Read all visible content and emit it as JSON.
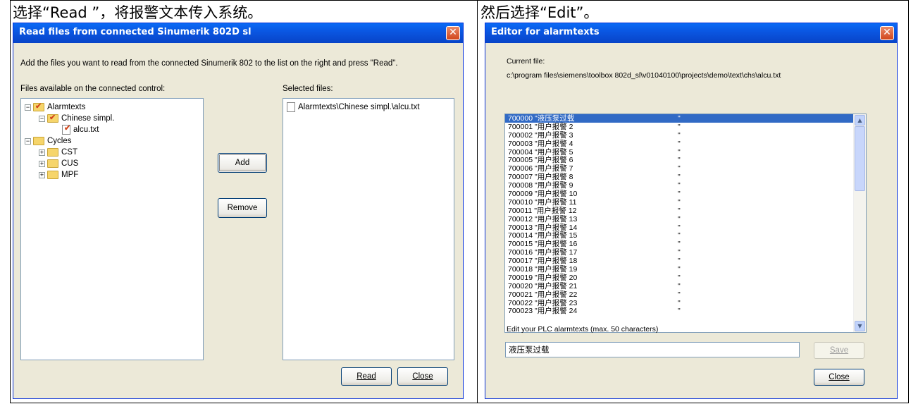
{
  "captions": {
    "left": "选择“Read ”，将报警文本传入系统。",
    "right": "然后选择“Edit”。"
  },
  "read_dialog": {
    "title": "Read files from connected Sinumerik 802D sl",
    "instruction": "Add the files you want to read from the connected Sinumerik 802 to the list on the right and press \"Read\".",
    "available_label": "Files available on the connected control:",
    "selected_label": "Selected files:",
    "tree": [
      {
        "label": "Alarmtexts"
      },
      {
        "label": "Chinese simpl."
      },
      {
        "label": "alcu.txt"
      },
      {
        "label": "Cycles"
      },
      {
        "label": "CST"
      },
      {
        "label": "CUS"
      },
      {
        "label": "MPF"
      }
    ],
    "selected_files": [
      "Alarmtexts\\Chinese simpl.\\alcu.txt"
    ],
    "add_label": "Add",
    "remove_label": "Remove",
    "read_label": "Read",
    "close_label": "Close"
  },
  "editor_dialog": {
    "title": "Editor for alarmtexts",
    "current_file_label": "Current file:",
    "current_file_path": "c:\\program files\\siemens\\toolbox 802d_sl\\v01040100\\projects\\demo\\text\\chs\\alcu.txt",
    "alarms": [
      {
        "code": "700000",
        "text": "\"液压泵过载",
        "end": "\"",
        "selected": true
      },
      {
        "code": "700001",
        "text": "\"用户报警 2",
        "end": "\""
      },
      {
        "code": "700002",
        "text": "\"用户报警 3",
        "end": "\""
      },
      {
        "code": "700003",
        "text": "\"用户报警 4",
        "end": "\""
      },
      {
        "code": "700004",
        "text": "\"用户报警 5",
        "end": "\""
      },
      {
        "code": "700005",
        "text": "\"用户报警 6",
        "end": "\""
      },
      {
        "code": "700006",
        "text": "\"用户报警 7",
        "end": "\""
      },
      {
        "code": "700007",
        "text": "\"用户报警 8",
        "end": "\""
      },
      {
        "code": "700008",
        "text": "\"用户报警 9",
        "end": "\""
      },
      {
        "code": "700009",
        "text": "\"用户报警 10",
        "end": "\""
      },
      {
        "code": "700010",
        "text": "\"用户报警 11",
        "end": "\""
      },
      {
        "code": "700011",
        "text": "\"用户报警 12",
        "end": "\""
      },
      {
        "code": "700012",
        "text": "\"用户报警 13",
        "end": "\""
      },
      {
        "code": "700013",
        "text": "\"用户报警 14",
        "end": "\""
      },
      {
        "code": "700014",
        "text": "\"用户报警 15",
        "end": "\""
      },
      {
        "code": "700015",
        "text": "\"用户报警 16",
        "end": "\""
      },
      {
        "code": "700016",
        "text": "\"用户报警 17",
        "end": "\""
      },
      {
        "code": "700017",
        "text": "\"用户报警 18",
        "end": "\""
      },
      {
        "code": "700018",
        "text": "\"用户报警 19",
        "end": "\""
      },
      {
        "code": "700019",
        "text": "\"用户报警 20",
        "end": "\""
      },
      {
        "code": "700020",
        "text": "\"用户报警 21",
        "end": "\""
      },
      {
        "code": "700021",
        "text": "\"用户报警 22",
        "end": "\""
      },
      {
        "code": "700022",
        "text": "\"用户报警 23",
        "end": "\""
      },
      {
        "code": "700023",
        "text": "\"用户报警 24",
        "end": "\""
      }
    ],
    "edit_label": "Edit your PLC alarmtexts (max. 50 characters)",
    "edit_value": "液压泵过载",
    "save_label": "Save",
    "close_label": "Close"
  }
}
